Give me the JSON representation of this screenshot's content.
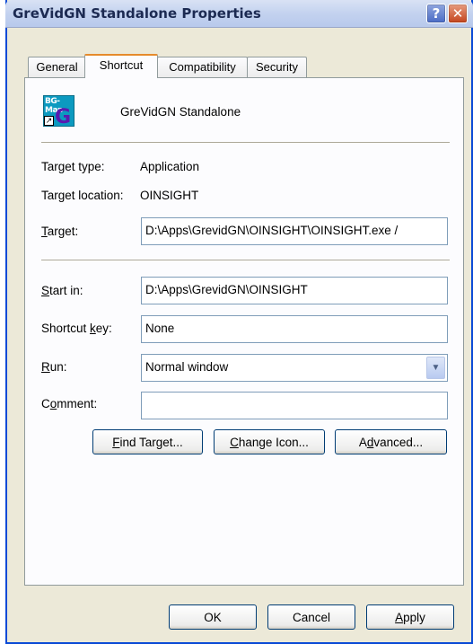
{
  "window": {
    "title": "GreVidGN Standalone Properties",
    "help_label": "?",
    "close_label": "✕"
  },
  "tabs": [
    {
      "label": "General"
    },
    {
      "label": "Shortcut",
      "active": true
    },
    {
      "label": "Compatibility"
    },
    {
      "label": "Security"
    }
  ],
  "shortcut": {
    "icon_text": "BG-Map",
    "icon_letter": "G",
    "name": "GreVidGN Standalone",
    "target_type_label": "Target type:",
    "target_type_value": "Application",
    "target_location_label": "Target location:",
    "target_location_value": "OINSIGHT",
    "target_label": "Target:",
    "target_value": "D:\\Apps\\GrevidGN\\OINSIGHT\\OINSIGHT.exe /",
    "start_in_label": "Start in:",
    "start_in_value": "D:\\Apps\\GrevidGN\\OINSIGHT",
    "shortcut_key_label": "Shortcut key:",
    "shortcut_key_value": "None",
    "run_label": "Run:",
    "run_value": "Normal window",
    "comment_label": "Comment:",
    "comment_value": "",
    "find_target_label": "Find Target...",
    "change_icon_label": "Change Icon...",
    "advanced_label": "Advanced..."
  },
  "footer": {
    "ok_label": "OK",
    "cancel_label": "Cancel",
    "apply_label": "Apply"
  }
}
